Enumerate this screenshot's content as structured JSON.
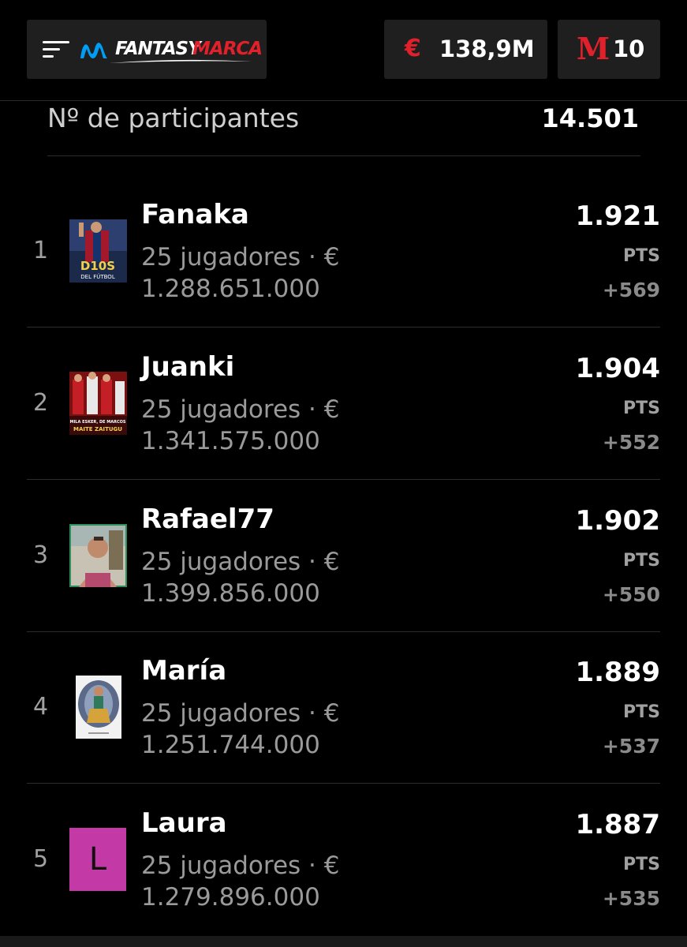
{
  "header": {
    "brand_left": "FANTASY",
    "brand_right": "MARCA",
    "budget": "138,9M",
    "coins": "10",
    "icons": [
      "menu-icon",
      "movistar-logo-icon",
      "euro-icon",
      "marca-m-icon"
    ],
    "accent_color": "#e0202a",
    "movistar_color": "#019df4"
  },
  "summary": {
    "participants_label": "Nº de participantes",
    "participants_value": "14.501"
  },
  "ranking": [
    {
      "rank": "1",
      "name": "Fanaka",
      "players": "25 jugadores · €",
      "value": "1.288.651.000",
      "points": "1.921",
      "pts_label": "PTS",
      "delta": "+569",
      "avatar_text": "D10S",
      "avatar_subtext": "DEL FÚTBOL"
    },
    {
      "rank": "2",
      "name": "Juanki",
      "players": "25 jugadores · €",
      "value": "1.341.575.000",
      "points": "1.904",
      "pts_label": "PTS",
      "delta": "+552",
      "avatar_text": "MILA ESKER, DE MARCOS",
      "avatar_subtext": "MAITE ZAITUGU"
    },
    {
      "rank": "3",
      "name": "Rafael77",
      "players": "25 jugadores · €",
      "value": "1.399.856.000",
      "points": "1.902",
      "pts_label": "PTS",
      "delta": "+550"
    },
    {
      "rank": "4",
      "name": "María",
      "players": "25 jugadores · €",
      "value": "1.251.744.000",
      "points": "1.889",
      "pts_label": "PTS",
      "delta": "+537"
    },
    {
      "rank": "5",
      "name": "Laura",
      "players": "25 jugadores · €",
      "value": "1.279.896.000",
      "points": "1.887",
      "pts_label": "PTS",
      "delta": "+535",
      "avatar_letter": "L",
      "avatar_color": "#c33aa6"
    }
  ]
}
